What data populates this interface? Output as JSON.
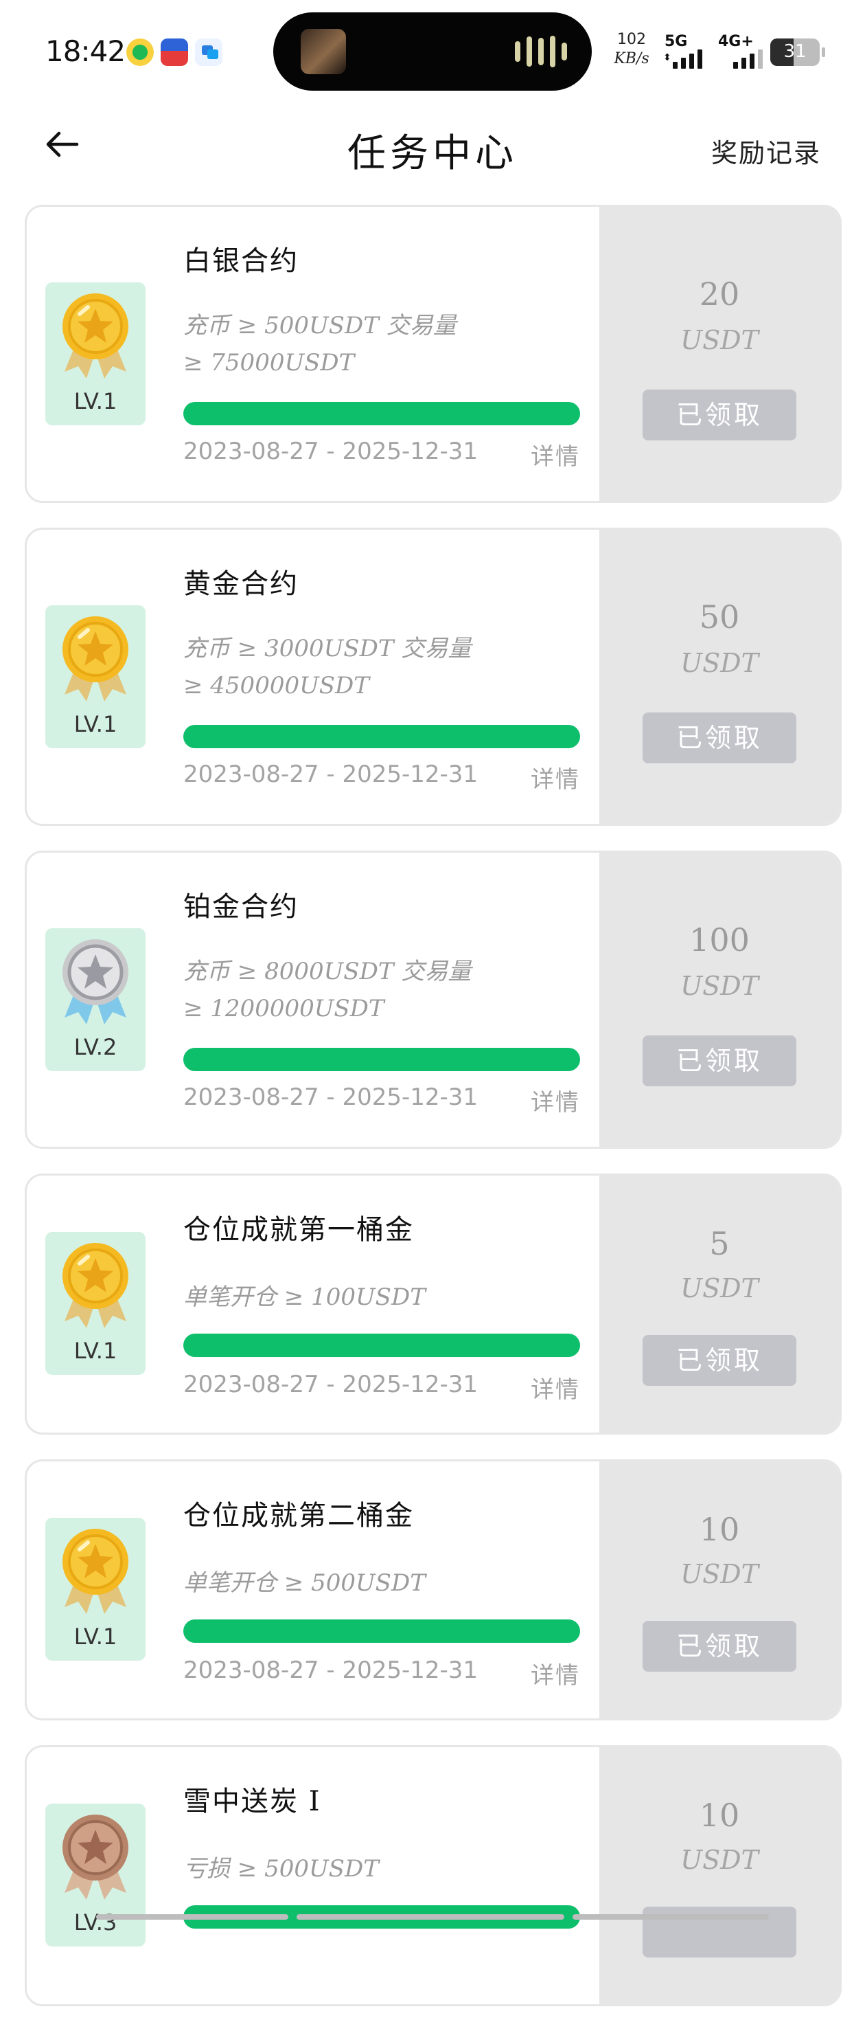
{
  "status_bar": {
    "time": "18:42",
    "net_speed_value": "102",
    "net_speed_unit": "KB/s",
    "signal_1_label": "5G",
    "signal_2_label": "4G+",
    "battery": "31",
    "icons": [
      "qq-music-icon",
      "shopping-app-icon",
      "message-app-icon",
      "album-art-icon",
      "audio-wave-icon"
    ]
  },
  "header": {
    "title": "任务中心",
    "records_link": "奖励记录",
    "back_icon": "arrow-left-icon"
  },
  "tasks": [
    {
      "title": "白银合约",
      "condition_line1": "充币 ≥ 500USDT 交易量",
      "condition_line2": "≥ 75000USDT",
      "progress": 1.0,
      "period": "2023-08-27 - 2025-12-31",
      "detail": "详情",
      "level": "LV.1",
      "medal": "gold-medal-icon",
      "reward_amount": "20",
      "reward_unit": "USDT",
      "status": "已领取"
    },
    {
      "title": "黄金合约",
      "condition_line1": "充币 ≥ 3000USDT 交易量",
      "condition_line2": "≥ 450000USDT",
      "progress": 1.0,
      "period": "2023-08-27 - 2025-12-31",
      "detail": "详情",
      "level": "LV.1",
      "medal": "gold-medal-icon",
      "reward_amount": "50",
      "reward_unit": "USDT",
      "status": "已领取"
    },
    {
      "title": "铂金合约",
      "condition_line1": "充币 ≥ 8000USDT 交易量",
      "condition_line2": "≥ 1200000USDT",
      "progress": 1.0,
      "period": "2023-08-27 - 2025-12-31",
      "detail": "详情",
      "level": "LV.2",
      "medal": "silver-medal-icon",
      "reward_amount": "100",
      "reward_unit": "USDT",
      "status": "已领取"
    },
    {
      "title": "仓位成就第一桶金",
      "condition_line1": "单笔开仓 ≥ 100USDT",
      "progress": 1.0,
      "period": "2023-08-27 - 2025-12-31",
      "detail": "详情",
      "level": "LV.1",
      "medal": "gold-medal-icon",
      "reward_amount": "5",
      "reward_unit": "USDT",
      "status": "已领取"
    },
    {
      "title": "仓位成就第二桶金",
      "condition_line1": "单笔开仓 ≥ 500USDT",
      "progress": 1.0,
      "period": "2023-08-27 - 2025-12-31",
      "detail": "详情",
      "level": "LV.1",
      "medal": "gold-medal-icon",
      "reward_amount": "10",
      "reward_unit": "USDT",
      "status": "已领取"
    },
    {
      "title": "雪中送炭 I",
      "condition_line1": "亏损 ≥ 500USDT",
      "progress": 1.0,
      "level": "LV.3",
      "medal": "bronze-medal-icon",
      "reward_amount": "10",
      "reward_unit": "USDT"
    }
  ],
  "colors": {
    "progress": "#0dbe6b",
    "badge_bg": "#d4f2e3",
    "panel_bg": "#e6e6e6",
    "button_bg": "#c3c3ca"
  }
}
